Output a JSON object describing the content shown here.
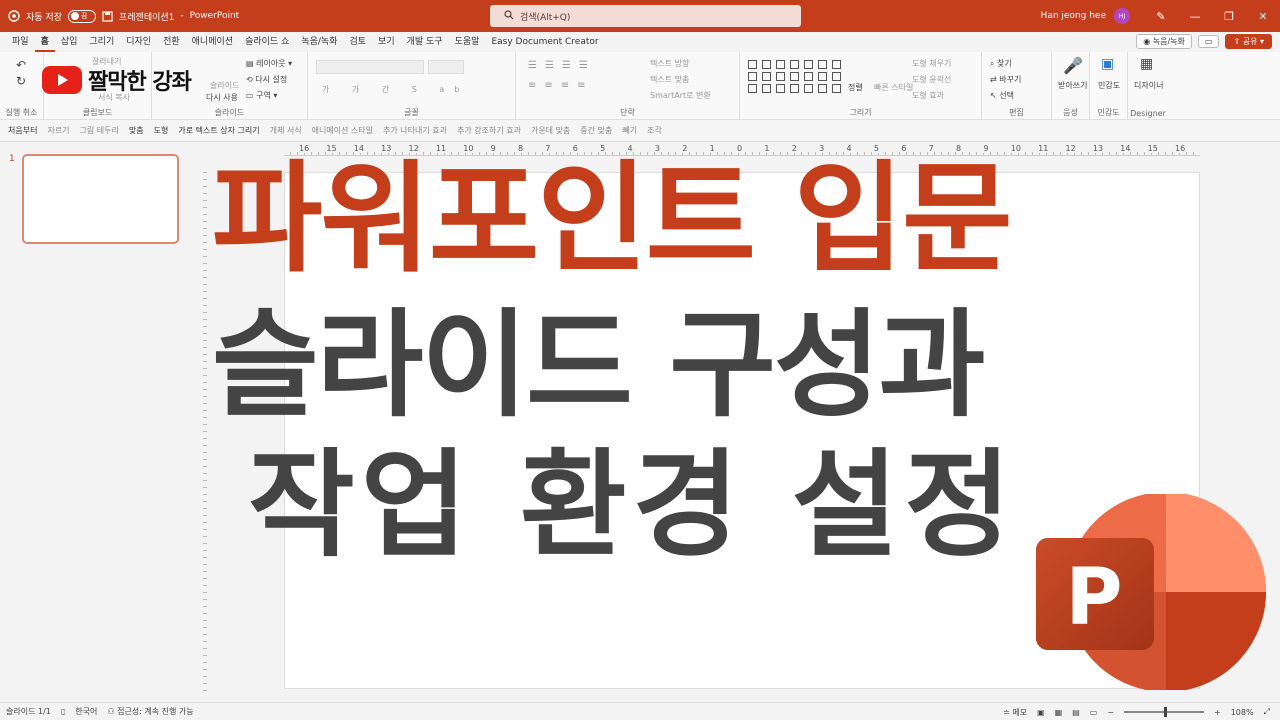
{
  "titlebar": {
    "autosave_label": "자동 저장",
    "autosave_state": "끔",
    "doc_title": "프레젠테이션1",
    "separator": "-",
    "app_name": "PowerPoint",
    "search_placeholder": "검색(Alt+Q)",
    "user_name": "Han jeong hee",
    "user_initials": "HJ"
  },
  "menu": {
    "tabs": [
      "파일",
      "홈",
      "삽입",
      "그리기",
      "디자인",
      "전환",
      "애니메이션",
      "슬라이드 쇼",
      "녹음/녹화",
      "검토",
      "보기",
      "개발 도구",
      "도움말",
      "Easy Document Creator"
    ],
    "record_button": "녹음/녹화",
    "share_button": "공유"
  },
  "ribbon": {
    "groups": [
      "실행 취소",
      "클립보드",
      "슬라이드",
      "글꼴",
      "단락",
      "그리기",
      "편집",
      "음성",
      "민감도",
      "Designer"
    ],
    "clipboard_cut": "잘라내기",
    "clipboard_copy": "서식 복사",
    "slide_layout": "레이아웃",
    "slide_reset": "다시 설정",
    "slide_new": "슬라이드",
    "slide_reuse": "다시 사용",
    "slide_section": "구역",
    "para_text_dir": "텍스트 방향",
    "para_align_text": "텍스트 맞춤",
    "para_smartart": "SmartArt로 변환",
    "draw_arrange": "정렬",
    "draw_quick_styles": "빠른 스타일",
    "draw_fill": "도형 채우기",
    "draw_outline": "도형 윤곽선",
    "draw_effects": "도형 효과",
    "edit_find": "찾기",
    "edit_replace": "바꾸기",
    "edit_select": "선택",
    "voice_dictate": "받아쓰기",
    "sensitivity": "민감도",
    "designer": "디자이너"
  },
  "overlay_logo": {
    "channel_name": "짤막한 강좌"
  },
  "quickbar": {
    "items": [
      "처음부터",
      "자르기",
      "그림 테두리",
      "맞춤",
      "도형",
      "가로 텍스트 상자 그리기",
      "개체 서식",
      "애니메이션 스타일",
      "추가 나타내기 효과",
      "추가 강조하기 효과",
      "가운데 맞춤",
      "중간 맞춤",
      "빼기",
      "조각"
    ]
  },
  "thumbnails": {
    "slide_number": "1"
  },
  "ruler": {
    "labels": [
      "16",
      "15",
      "14",
      "13",
      "12",
      "11",
      "10",
      "9",
      "8",
      "7",
      "6",
      "5",
      "4",
      "3",
      "2",
      "1",
      "0",
      "1",
      "2",
      "3",
      "4",
      "5",
      "6",
      "7",
      "8",
      "9",
      "10",
      "11",
      "12",
      "13",
      "14",
      "15",
      "16"
    ]
  },
  "slide": {
    "line1": "파워포인트 입문",
    "line2": "슬라이드 구성과",
    "line3": "작업 환경 설정"
  },
  "pp_logo": {
    "letter": "P"
  },
  "statusbar": {
    "slide_info": "슬라이드 1/1",
    "language": "한국어",
    "accessibility": "접근성: 계속 진행 가능",
    "notes": "메모",
    "zoom": "108%"
  },
  "colors": {
    "accent": "#c43e1c",
    "title_red": "#c43e1c",
    "title_gray": "#444444"
  }
}
